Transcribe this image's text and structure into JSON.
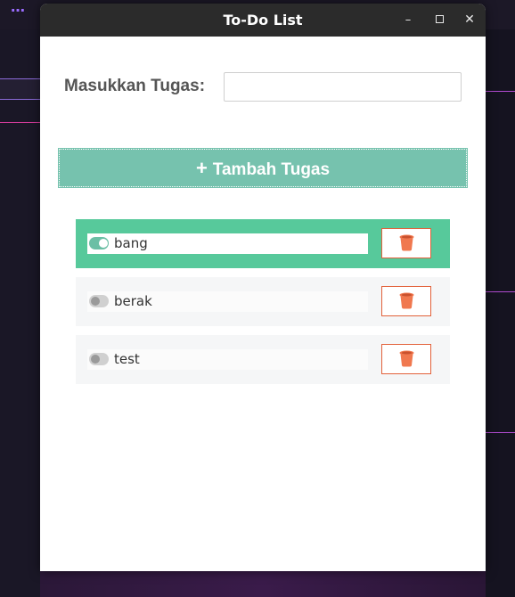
{
  "window": {
    "title": "To-Do List",
    "minimize_glyph": "–",
    "close_glyph": "✕"
  },
  "form": {
    "label": "Masukkan Tugas:",
    "input_value": "",
    "input_placeholder": ""
  },
  "add_button": {
    "icon": "+",
    "label": "Tambah Tugas"
  },
  "tasks": [
    {
      "text": "bang",
      "done": true
    },
    {
      "text": "berak",
      "done": false
    },
    {
      "text": "test",
      "done": false
    }
  ],
  "colors": {
    "accent": "#76c2ae",
    "active_row": "#57c99b",
    "delete": "#e2613a",
    "titlebar": "#2b2b2b"
  },
  "icons": {
    "delete": "trash-icon",
    "toggle": "toggle-icon"
  }
}
